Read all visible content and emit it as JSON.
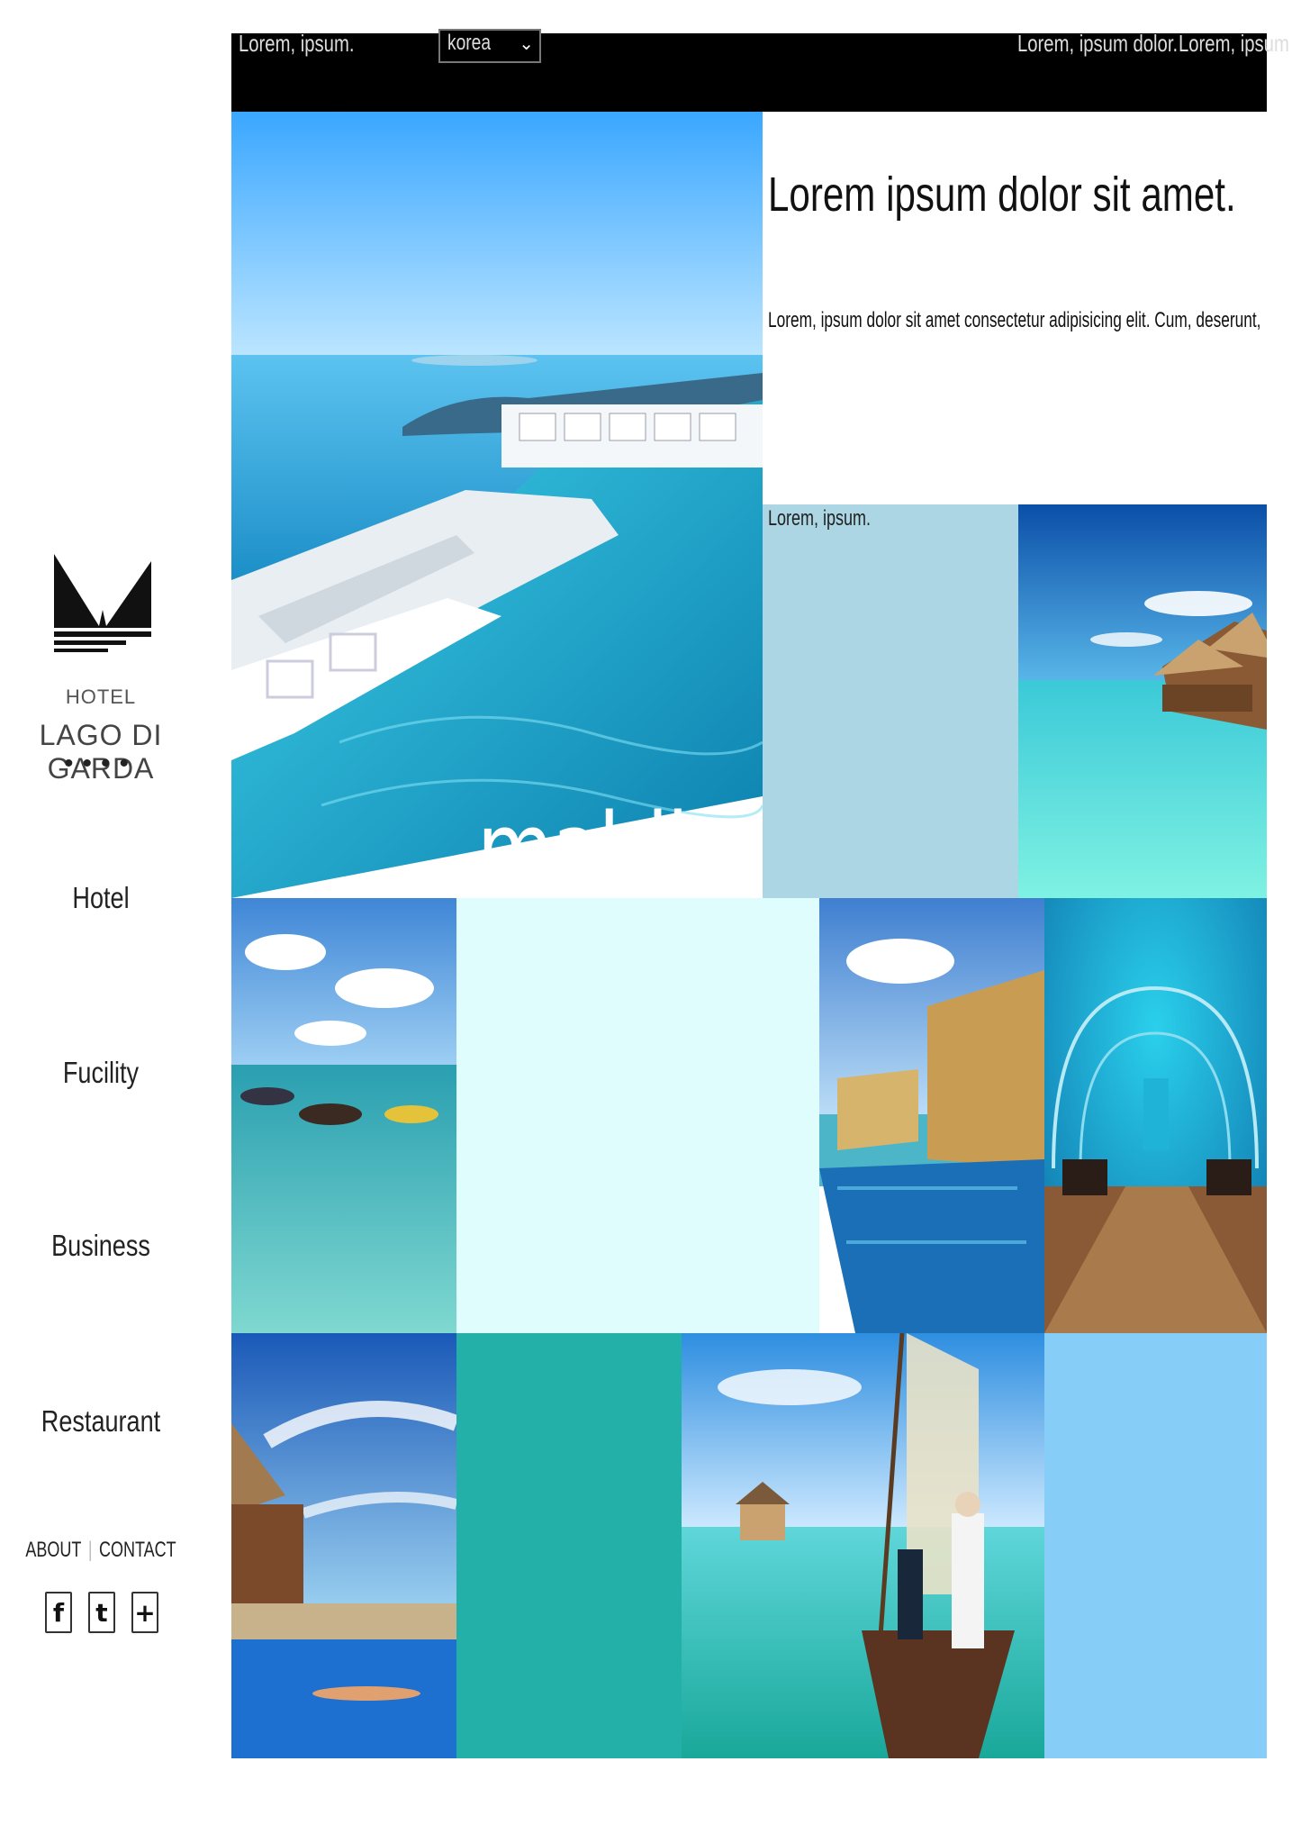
{
  "topbar": {
    "left_text": "Lorem, ipsum.",
    "select_value": "korea",
    "right_text_1": "Lorem, ipsum dolor.",
    "right_text_2": "Lorem, ipsum"
  },
  "sidebar": {
    "hotel_small": "HOTEL",
    "hotel_name": "LAGO DI GARDA",
    "stars": "••••",
    "nav": [
      "Hotel",
      "Fucility",
      "Business",
      "Restaurant"
    ],
    "footer": {
      "about": "ABOUT",
      "separator": "|",
      "contact": "CONTACT"
    },
    "social": [
      {
        "icon": "facebook-icon",
        "glyph": "f"
      },
      {
        "icon": "twitter-icon",
        "glyph": "t"
      },
      {
        "icon": "plus-icon",
        "glyph": "+"
      }
    ]
  },
  "main": {
    "hero_caption": "maldieves",
    "heading": "Lorem ipsum dolor sit amet.",
    "paragraph": "Lorem, ipsum dolor sit amet consectetur adipisicing elit. Cum, deserunt,",
    "tile_label": "Lorem, ipsum."
  },
  "colors": {
    "light_blue_tile": "#acd6e4",
    "pale_cyan_tile": "#e0fdfd",
    "teal_tile": "#22b0a8",
    "sky_tile": "#86cdf8"
  }
}
